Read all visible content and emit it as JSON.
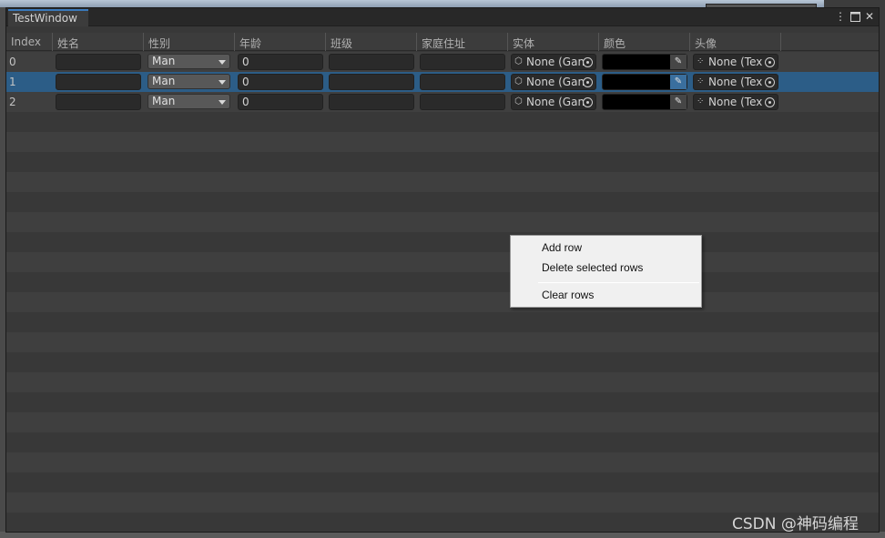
{
  "window": {
    "tab_title": "TestWindow"
  },
  "columns": [
    "Index",
    "姓名",
    "性别",
    "年龄",
    "班级",
    "家庭住址",
    "实体",
    "颜色",
    "头像"
  ],
  "rows": [
    {
      "index": "0",
      "name": "",
      "gender": "Man",
      "age": "0",
      "class": "",
      "address": "",
      "entity": "None (Gan",
      "color": "#000000",
      "avatar": "None (Tex"
    },
    {
      "index": "1",
      "name": "",
      "gender": "Man",
      "age": "0",
      "class": "",
      "address": "",
      "entity": "None (Gan",
      "color": "#000000",
      "avatar": "None (Tex"
    },
    {
      "index": "2",
      "name": "",
      "gender": "Man",
      "age": "0",
      "class": "",
      "address": "",
      "entity": "None (Gan",
      "color": "#000000",
      "avatar": "None (Tex"
    }
  ],
  "selected_row": "1",
  "context_menu": {
    "add_row": "Add row",
    "delete_selected": "Delete selected rows",
    "clear_rows": "Clear rows"
  },
  "watermark": "CSDN @神码编程",
  "colors": {
    "selection": "#2c5d87",
    "tab_accent": "#3a79bb",
    "background": "#383838"
  }
}
